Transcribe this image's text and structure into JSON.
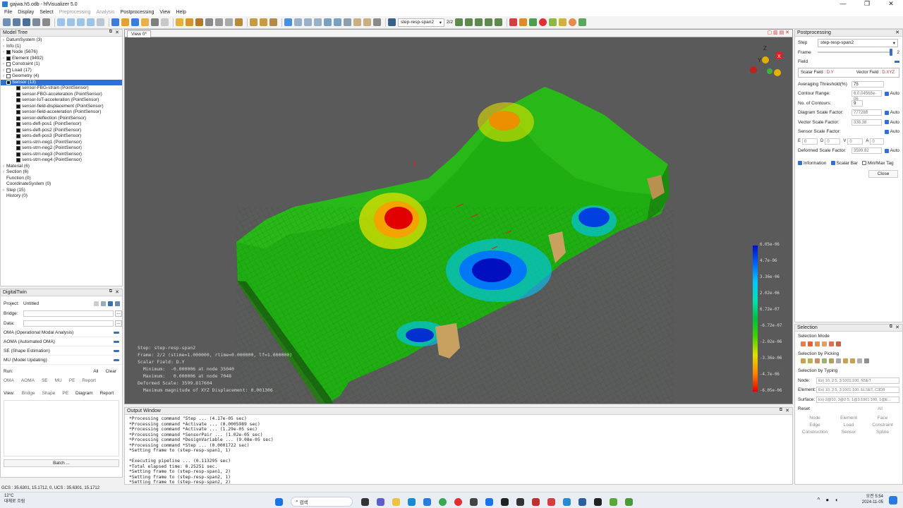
{
  "window": {
    "title": "gajwa.h5.odb - hfVisualizer 5.0",
    "controls": [
      "—",
      "❐",
      "✕"
    ]
  },
  "menu": [
    {
      "label": "File",
      "enabled": true
    },
    {
      "label": "Display",
      "enabled": true
    },
    {
      "label": "Select",
      "enabled": true
    },
    {
      "label": "Preprocessing",
      "enabled": false
    },
    {
      "label": "Analysis",
      "enabled": false
    },
    {
      "label": "Postprocessing",
      "enabled": true
    },
    {
      "label": "View",
      "enabled": true
    },
    {
      "label": "Help",
      "enabled": true
    }
  ],
  "toolbar": {
    "step_combo": "step-resp-span2",
    "frame_counter": "2/2"
  },
  "model_tree": {
    "title": "Model Tree",
    "items": [
      {
        "label": "DatumSystem (3)",
        "expander": "›",
        "checkbox": "none",
        "indent": 0
      },
      {
        "label": "Info (1)",
        "expander": "›",
        "checkbox": "none",
        "indent": 0
      },
      {
        "label": "Node (5676)",
        "expander": "›",
        "checkbox": "on",
        "indent": 0
      },
      {
        "label": "Element (9492)",
        "expander": "›",
        "checkbox": "on",
        "indent": 0
      },
      {
        "label": "Constraint (1)",
        "expander": "›",
        "checkbox": "off",
        "indent": 0
      },
      {
        "label": "Load (17)",
        "expander": "›",
        "checkbox": "off",
        "indent": 0
      },
      {
        "label": "Geometry (4)",
        "expander": "›",
        "checkbox": "off",
        "indent": 0
      },
      {
        "label": "Sensor (13)",
        "expander": "⌄",
        "checkbox": "on",
        "indent": 0,
        "selected": true
      },
      {
        "label": "sensor-FBG-strain (PointSensor)",
        "checkbox": "on",
        "indent": 1
      },
      {
        "label": "sensor-FBG-acceleration (PointSensor)",
        "checkbox": "on",
        "indent": 1
      },
      {
        "label": "sensor-IoT-acceleration (PointSensor)",
        "checkbox": "on",
        "indent": 1
      },
      {
        "label": "sensor-field-displacement (PointSensor)",
        "checkbox": "on",
        "indent": 1
      },
      {
        "label": "sensor-field-acceleration (PointSensor)",
        "checkbox": "on",
        "indent": 1
      },
      {
        "label": "sensor-deflection (PointSensor)",
        "checkbox": "on",
        "indent": 1
      },
      {
        "label": "sens-defl-pos1 (PointSensor)",
        "checkbox": "on",
        "indent": 1
      },
      {
        "label": "sens-defl-pos2 (PointSensor)",
        "checkbox": "on",
        "indent": 1
      },
      {
        "label": "sens-defl-pos3 (PointSensor)",
        "checkbox": "on",
        "indent": 1
      },
      {
        "label": "sens-strn-neg1 (PointSensor)",
        "checkbox": "on",
        "indent": 1
      },
      {
        "label": "sens-strn-neg2 (PointSensor)",
        "checkbox": "on",
        "indent": 1
      },
      {
        "label": "sens-strn-neg3 (PointSensor)",
        "checkbox": "on",
        "indent": 1
      },
      {
        "label": "sens-strn-neg4 (PointSensor)",
        "checkbox": "on",
        "indent": 1
      },
      {
        "label": "Material (6)",
        "expander": "›",
        "checkbox": "none",
        "indent": 0
      },
      {
        "label": "Section (6)",
        "expander": "›",
        "checkbox": "none",
        "indent": 0
      },
      {
        "label": "Function (0)",
        "expander": "",
        "checkbox": "none",
        "indent": 0
      },
      {
        "label": "CoordinateSystem (0)",
        "expander": "",
        "checkbox": "none",
        "indent": 0
      },
      {
        "label": "Step (15)",
        "expander": "›",
        "checkbox": "none",
        "indent": 0
      },
      {
        "label": "History (0)",
        "expander": "",
        "checkbox": "none",
        "indent": 0
      }
    ]
  },
  "digital_twin": {
    "title": "DigitalTwin",
    "project_label": "Project:",
    "project_value": "Untitled",
    "bridge_label": "Bridge:",
    "data_label": "Data:",
    "modules": [
      "OMA (Operational Modal Analysis)",
      "AOMA (Automated OMA)",
      "SE (Shape Estimation)",
      "MU (Model Updating)"
    ],
    "run_label": "Run:",
    "run_all": "All",
    "run_clear": "Clear",
    "run_buttons": [
      "OMA",
      "AOMA",
      "SE",
      "MU",
      "PE",
      "Report"
    ],
    "view_label": "View:",
    "view_buttons": [
      "Bridge",
      "Shape",
      "PE",
      "Diagram",
      "Report"
    ],
    "batch_button": "Batch ..."
  },
  "viewport": {
    "tab": "View 0*",
    "info_lines": [
      "Step: step-resp-span2",
      "Frame: 2/2 (stime=1.000000, rtime=0.000000, lf=1.000000)",
      "Scalar Field: D.Y",
      "  Minimum:  -0.000006 at node 35040",
      "  Maximum:   0.000006 at node 7048",
      "Deformed Scale: 3599.817604",
      "  Maximum magnitude of XYZ Displacement: 0.001306"
    ],
    "axis_labels": {
      "z": "Z",
      "y": "Y",
      "x": "X"
    },
    "legend": [
      "6.05e-06",
      "4.7e-06",
      "3.36e-06",
      "2.02e-06",
      "6.72e-07",
      "-6.72e-07",
      "-2.02e-06",
      "-3.36e-06",
      "-4.7e-06",
      "-6.05e-06"
    ],
    "colors": {
      "background": "#5a5a5a"
    }
  },
  "postprocessing": {
    "title": "Postprocessing",
    "step_label": "Step",
    "step_value": "step-resp-span2",
    "frame_label": "Frame",
    "frame_value": "2",
    "field_label": "Field",
    "scalar_label": "Scalar Field :",
    "scalar_value": "D.Y",
    "vector_label": "Vector Field :",
    "vector_value": "D.XYZ",
    "averaging_label": "Averaging Threshold(%)",
    "averaging_value": "75",
    "contour_range_label": "Contour Range:",
    "contour_range_value": "6.0.04568e-06",
    "contours_label": "No. of Contours:",
    "contours_value": "9",
    "diagram_label": "Diagram Scale Factor:",
    "diagram_value": "777288",
    "vector_scale_label": "Vector Scale Factor:",
    "vector_scale_value": "338.38",
    "sensor_scale_label": "Sensor Scale Factor:",
    "deformed_label": "Deformed Scale Factor:",
    "deformed_value": "3599.82",
    "auto_label": "Auto",
    "e_label": "E",
    "e_value": "0",
    "d_label": "D",
    "d_value": "0",
    "v_label": "V",
    "v_value": "0",
    "a_label": "A",
    "a_value": "0",
    "information_label": "Information",
    "scalar_bar_label": "Scalar Bar",
    "minmax_label": "Min/Max Tag",
    "close_button": "Close"
  },
  "selection": {
    "title": "Selection",
    "mode_label": "Selection Mode",
    "picking_label": "Selection by Picking",
    "typing_label": "Selection by Typing",
    "node_label": "Node:",
    "node_ph": "Ex) 10, 2:5, 3:1001:100, NSET",
    "element_label": "Element:",
    "element_ph": "Ex) 10, 2:5, 3:1001:100, ELSET, C3D8",
    "surface_label": "Surface:",
    "surface_ph": "Ex) 2@10, 3@2:5, 1@3:1001:100, 1@E...",
    "reset_label": "Reset",
    "reset_all": "All",
    "reset_buttons": [
      "Node",
      "Element",
      "Face",
      "Edge",
      "Load",
      "Constraint",
      "Construction",
      "Sensor",
      "Spline"
    ]
  },
  "output": {
    "title": "Output Window",
    "lines": [
      "*Processing command \"Step ... (4.17e-05 sec)",
      "*Processing command *Activate ... (0.0005989 sec)",
      "*Processing command *Activate ... (1.29e-05 sec)",
      "*Processing command *SensorPair ... (1.02e-05 sec)",
      "*Processing command *DesignVariable ... (9.08e-05 sec)",
      "*Processing command *Step ... (0.0001722 sec)",
      "*Setting frame to (step-resp-span1, 1)",
      "",
      "*Executing pipeline ... (0.113295 sec)",
      "*Total elapsed time: 0.25251 sec.",
      "*Setting frame to (step-resp-span1, 2)",
      "*Setting frame to (step-resp-span2, 1)",
      "*Setting frame to (step-resp-span2, 2)"
    ]
  },
  "status": {
    "text": "GCS : 35.6301, 15.1712, 0, UCS : 35.6301, 15.1712"
  },
  "taskbar": {
    "weather_temp": "12°C",
    "weather_text": "대체로 흐림",
    "search_label": "검색",
    "time": "오전 5:54",
    "date": "2024-11-05"
  }
}
